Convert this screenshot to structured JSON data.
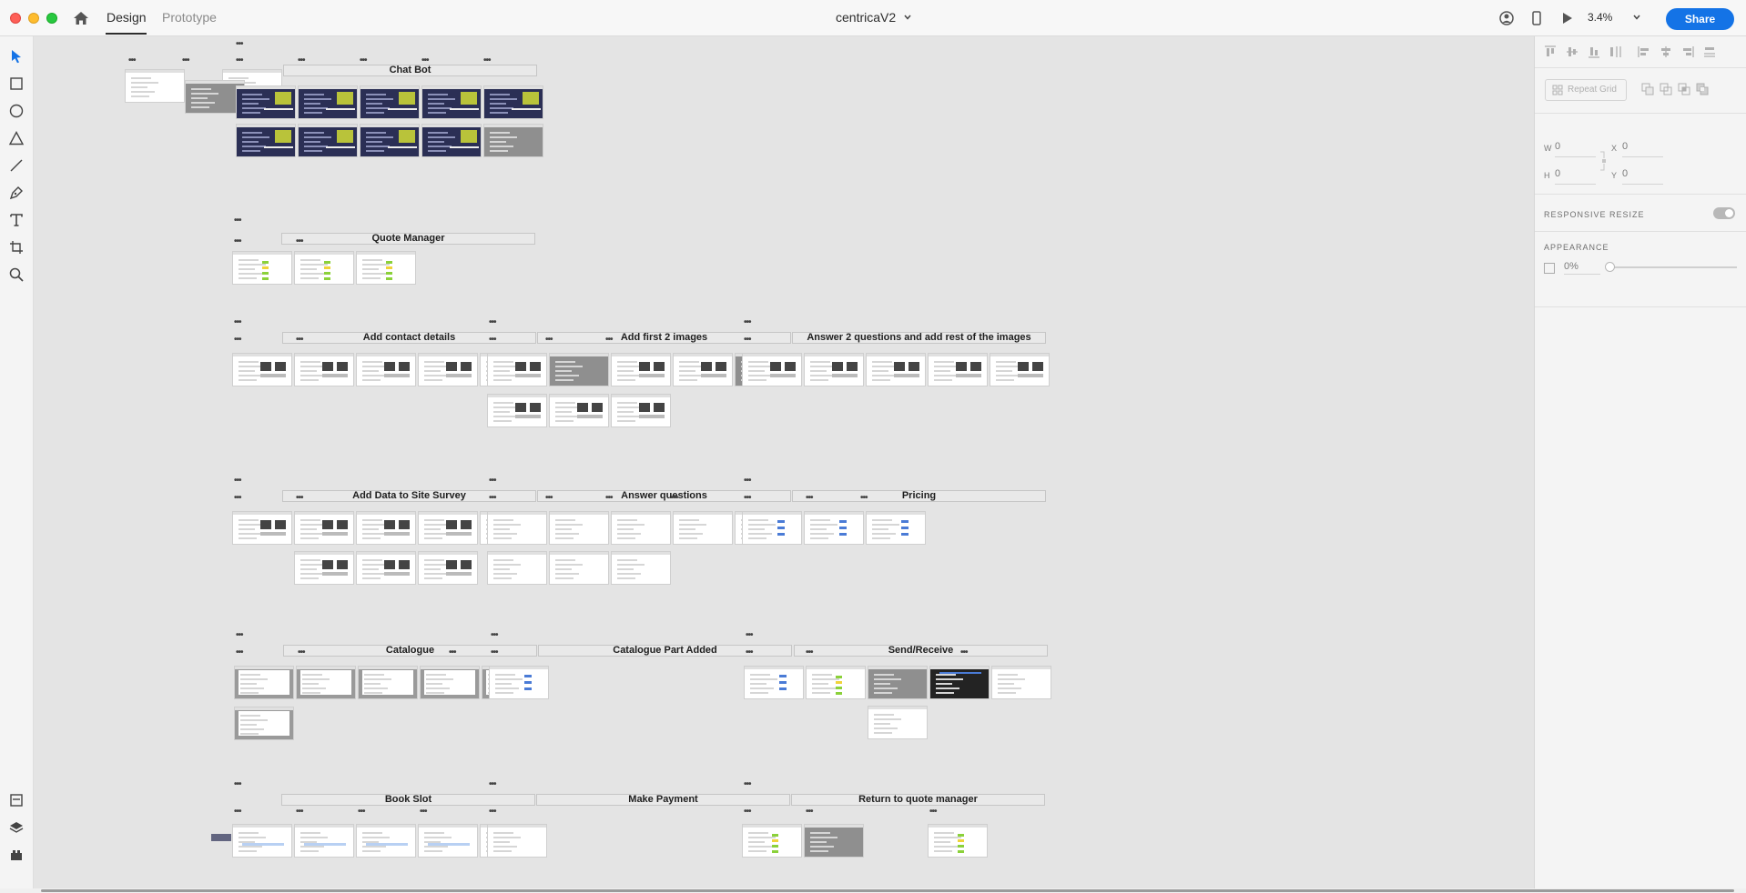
{
  "titlebar": {
    "tabs": [
      {
        "label": "Design"
      },
      {
        "label": "Prototype"
      }
    ],
    "document_title": "centricaV2",
    "zoom": "3.4%",
    "share_label": "Share"
  },
  "left_toolbar": {
    "tools": [
      "select",
      "rectangle",
      "ellipse",
      "triangle",
      "line",
      "pen",
      "text",
      "artboard",
      "zoom"
    ],
    "bottom": [
      "document-assets",
      "layers",
      "plugins"
    ]
  },
  "right_panel": {
    "repeat_grid_label": "Repeat Grid",
    "fields": {
      "w_label": "W",
      "w": "0",
      "x_label": "X",
      "x": "0",
      "h_label": "H",
      "h": "0",
      "y_label": "Y",
      "y": "0"
    },
    "responsive_resize": "RESPONSIVE RESIZE",
    "appearance": "APPEARANCE",
    "opacity": "0%"
  },
  "canvas": {
    "groups": [
      {
        "title": "Chat Bot"
      },
      {
        "title": "Quote Manager"
      },
      {
        "title": "Add contact details"
      },
      {
        "title": "Add first 2 images"
      },
      {
        "title": "Answer 2 questions and add rest of the images"
      },
      {
        "title": "Add Data to Site Survey"
      },
      {
        "title": "Answer questions"
      },
      {
        "title": "Pricing"
      },
      {
        "title": "Catalogue"
      },
      {
        "title": "Catalogue Part Added"
      },
      {
        "title": "Send/Receive"
      },
      {
        "title": "Book Slot"
      },
      {
        "title": "Make Payment"
      },
      {
        "title": "Return to quote manager"
      }
    ],
    "colors": {
      "accent": "#1473e6",
      "chatbot_dark": "#2b2f55",
      "status_green": "#8bd13a"
    }
  }
}
